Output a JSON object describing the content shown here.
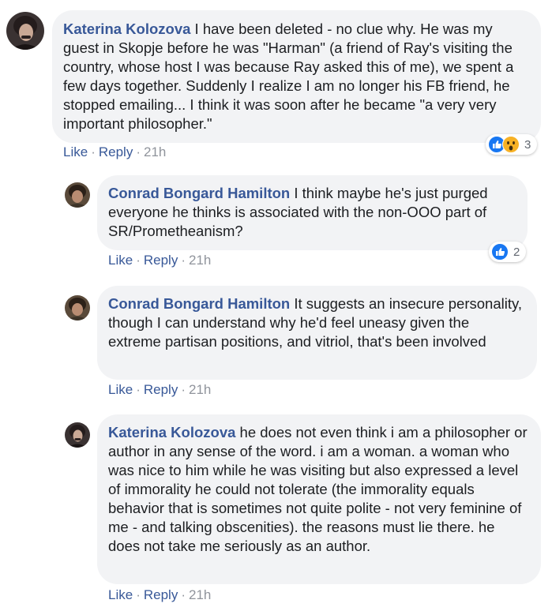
{
  "comments": [
    {
      "author": "Katerina Kolozova",
      "text": " I have been deleted - no clue why. He was my guest in Skopje before he was \"Harman\" (a friend of Ray's visiting the country, whose host I was because Ray asked this of me), we spent a few days together. Suddenly I realize I am no longer his FB friend, he stopped emailing... I think it was soon after he became \"a very very important philosopher.\"",
      "like": "Like",
      "reply": "Reply",
      "time": "21h",
      "reactions": {
        "icons": [
          "like-reaction-icon",
          "wow-reaction-icon"
        ],
        "count": "3"
      }
    },
    {
      "author": "Conrad Bongard Hamilton",
      "text": " I think maybe he's just purged everyone he thinks is associated with the non-OOO part of SR/Prometheanism?",
      "like": "Like",
      "reply": "Reply",
      "time": "21h",
      "reactions": {
        "icons": [
          "like-reaction-icon"
        ],
        "count": "2"
      }
    },
    {
      "author": "Conrad Bongard Hamilton",
      "text": " It suggests an insecure personality, though I can understand why he'd feel uneasy given the extreme partisan positions, and vitriol, that's been involved",
      "like": "Like",
      "reply": "Reply",
      "time": "21h"
    },
    {
      "author": "Katerina Kolozova",
      "text": " he does not even think i am a philosopher or author in any sense of the word. i am a woman. a woman who was nice to him while he was visiting but also expressed a level of immorality he could not tolerate (the immorality equals behavior that is sometimes not quite polite - not very feminine of me - and talking obscenities). the reasons must lie there. he does not take me seriously as an author.",
      "like": "Like",
      "reply": "Reply",
      "time": "21h"
    }
  ],
  "separator": "·",
  "colors": {
    "author": "#385898",
    "bubble": "#f2f3f5",
    "meta": "#90949c",
    "like_reaction": "#1877f2",
    "wow_reaction": "#f7b125"
  }
}
